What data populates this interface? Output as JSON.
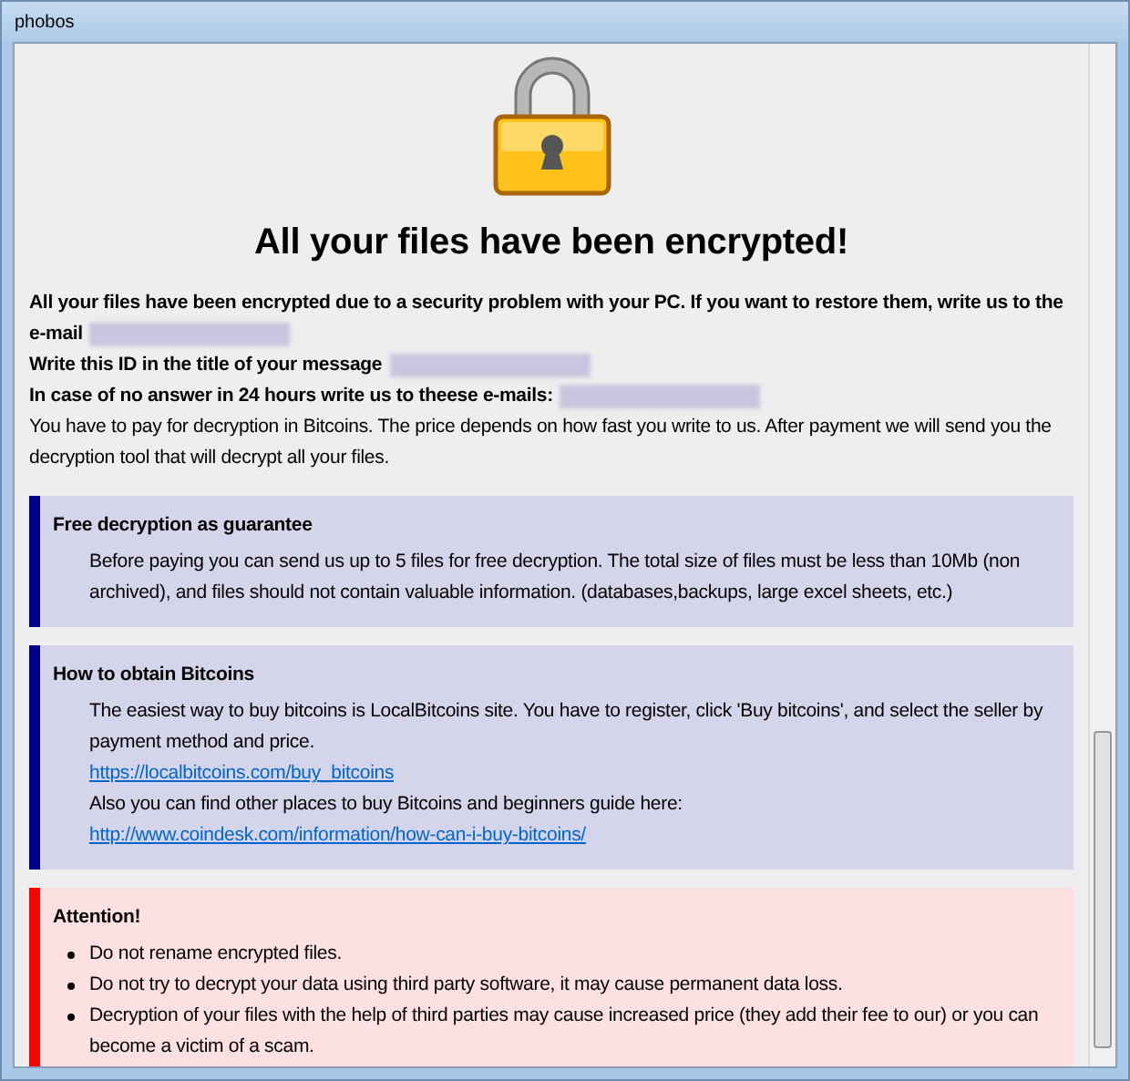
{
  "window": {
    "title": "phobos"
  },
  "heading": "All your files have been encrypted!",
  "intro": [
    {
      "kind": "bold",
      "text": "All your files have been encrypted due to a security problem with your PC. If you want to restore them, write us to the e-mail",
      "redacted": true
    },
    {
      "kind": "bold",
      "text": "Write this ID in the title of your message",
      "redacted": true
    },
    {
      "kind": "bold",
      "text": "In case of no answer in 24 hours write us to theese e-mails:",
      "redacted": true
    },
    {
      "kind": "plain",
      "text": "You have to pay for decryption in Bitcoins. The price depends on how fast you write to us. After payment we will send you the decryption tool that will decrypt all your files.",
      "redacted": false
    }
  ],
  "sections": [
    {
      "kind": "info",
      "title": "Free decryption as guarantee",
      "lines": [
        {
          "kind": "text",
          "text": "Before paying you can send us up to 5 files for free decryption. The total size of files must be less than 10Mb (non archived), and files should not contain valuable information. (databases,backups, large excel sheets, etc.)"
        }
      ]
    },
    {
      "kind": "info",
      "title": "How to obtain Bitcoins",
      "lines": [
        {
          "kind": "text",
          "text": "The easiest way to buy bitcoins is LocalBitcoins site. You have to register, click 'Buy bitcoins', and select the seller by payment method and price."
        },
        {
          "kind": "link",
          "text": "https://localbitcoins.com/buy_bitcoins"
        },
        {
          "kind": "text",
          "text": "Also you can find other places to buy Bitcoins and beginners guide here:"
        },
        {
          "kind": "link",
          "text": "http://www.coindesk.com/information/how-can-i-buy-bitcoins/"
        }
      ]
    },
    {
      "kind": "warning",
      "title": "Attention!",
      "lines": [
        {
          "kind": "bullet",
          "text": "Do not rename encrypted files."
        },
        {
          "kind": "bullet",
          "text": "Do not try to decrypt your data using third party software, it may cause permanent data loss."
        },
        {
          "kind": "bullet",
          "text": "Decryption of your files with the help of third parties may cause increased price (they add their fee to our) or you can become a victim of a scam."
        }
      ]
    }
  ]
}
